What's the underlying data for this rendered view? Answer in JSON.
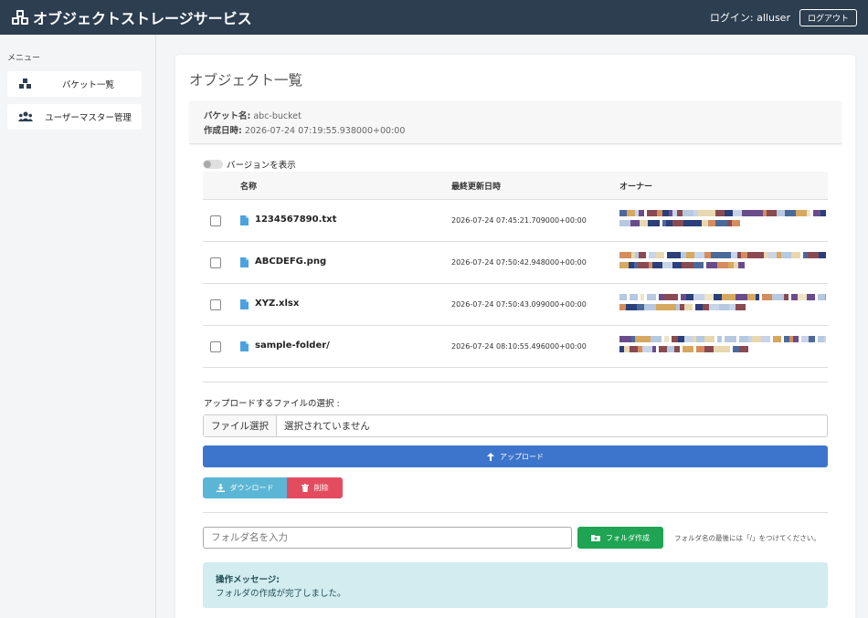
{
  "app": {
    "title": "オブジェクトストレージサービス"
  },
  "header": {
    "login_text": "ログイン: alluser",
    "logout_label": "ログアウト"
  },
  "sidebar": {
    "heading": "メニュー",
    "items": [
      {
        "label": "バケット一覧",
        "icon": "boxes-icon"
      },
      {
        "label": "ユーザーマスター管理",
        "icon": "users-icon"
      }
    ]
  },
  "main": {
    "title": "オブジェクト一覧",
    "bucket": {
      "name_key": "バケット名:",
      "name_value": "abc-bucket",
      "created_key": "作成日時:",
      "created_value": "2026-07-24 07:19:55.938000+00:00"
    },
    "version_toggle_label": "バージョンを表示",
    "table": {
      "columns": [
        "名称",
        "最終更新日時",
        "オーナー"
      ],
      "rows": [
        {
          "name": "1234567890.txt",
          "updated": "2026-07-24 07:45:21.709000+00:00"
        },
        {
          "name": "ABCDEFG.png",
          "updated": "2026-07-24 07:50:42.948000+00:00"
        },
        {
          "name": "XYZ.xlsx",
          "updated": "2026-07-24 07:50:43.099000+00:00"
        },
        {
          "name": "sample-folder/",
          "updated": "2026-07-24 08:10:55.496000+00:00"
        }
      ]
    },
    "upload": {
      "label": "アップロードするファイルの選択 :",
      "file_button": "ファイル選択",
      "file_status": "選択されていません",
      "upload_button": "アップロード"
    },
    "actions": {
      "download": "ダウンロード",
      "delete": "削除"
    },
    "folder": {
      "placeholder": "フォルダ名を入力",
      "create_button": "フォルダ作成",
      "hint": "フォルダ名の最後には「/」をつけてください。"
    },
    "message": {
      "title": "操作メッセージ:",
      "body": "フォルダの作成が完了しました。"
    }
  },
  "colors": {
    "header_bg": "#2c3e50",
    "primary": "#3d75cc",
    "info": "#5bb6d5",
    "danger": "#e34c5f",
    "success": "#1ea453",
    "alert_bg": "#d2ecef"
  }
}
